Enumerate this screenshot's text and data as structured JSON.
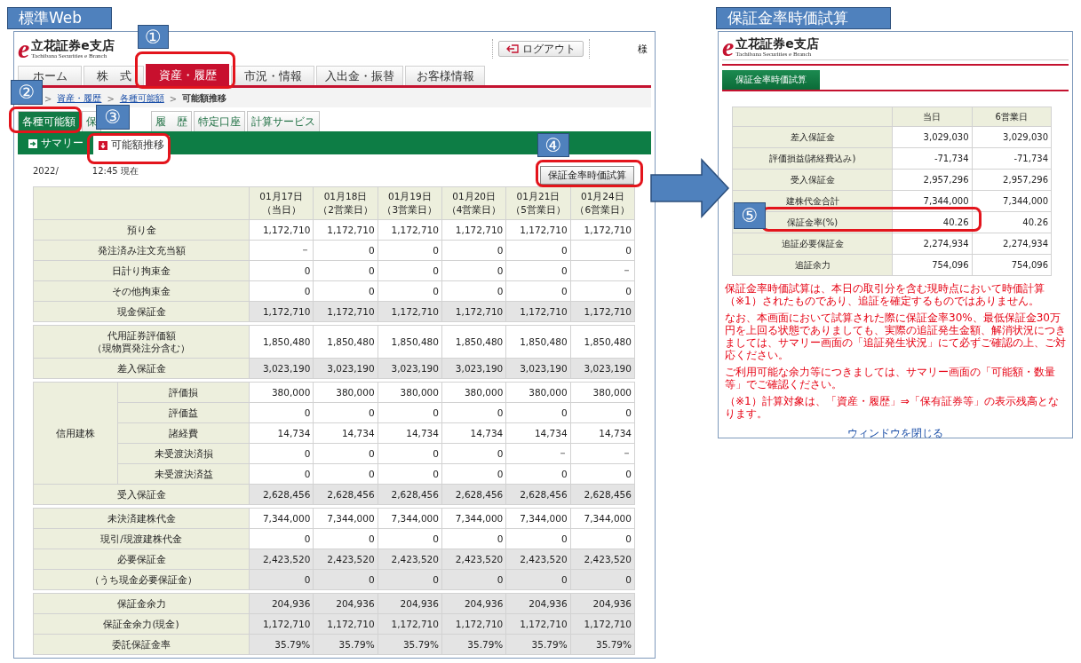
{
  "left_caption": "標準Web",
  "main_site": {
    "logo": {
      "mark": "e",
      "name": "立花証券e支店",
      "tagline": "Tachibana Securities e Branch"
    },
    "logout": "ログアウト",
    "user_suffix": "様",
    "nav": [
      {
        "label": "ホーム",
        "selected": false
      },
      {
        "label": "株　式",
        "selected": false
      },
      {
        "label": "資産・履歴",
        "selected": true
      },
      {
        "label": "市況・情報",
        "selected": false
      },
      {
        "label": "入出金・振替",
        "selected": false
      },
      {
        "label": "お客様情報",
        "selected": false
      }
    ],
    "breadcrumb": {
      "separator": ">",
      "items": [
        {
          "label": "資産・履歴",
          "link": true
        },
        {
          "label": "各種可能額",
          "link": true
        },
        {
          "label": "可能額推移",
          "link": false
        }
      ]
    },
    "subtabs": [
      {
        "label": "各種可能額",
        "selected": true
      },
      {
        "label": "保",
        "selected": false
      },
      {
        "label": "履　歴",
        "selected": false
      },
      {
        "label": "特定口座",
        "selected": false
      },
      {
        "label": "計算サービス",
        "selected": false
      }
    ],
    "view_tabs": [
      {
        "label": "サマリー",
        "selected": false
      },
      {
        "label": "可能額推移",
        "selected": true
      }
    ],
    "date": "2022/",
    "time": "12:45 現在",
    "calc_button": "保証金率時価試算",
    "table": {
      "columns": [
        {
          "date": "01月17日",
          "day": "（当日）"
        },
        {
          "date": "01月18日",
          "day": "（2営業日）"
        },
        {
          "date": "01月19日",
          "day": "（3営業日）"
        },
        {
          "date": "01月20日",
          "day": "（4営業日）"
        },
        {
          "date": "01月21日",
          "day": "（5営業日）"
        },
        {
          "date": "01月24日",
          "day": "（6営業日）"
        }
      ],
      "groups": [
        {
          "rows": [
            {
              "label": "預り金",
              "shaded": false,
              "values": [
                "1,172,710",
                "1,172,710",
                "1,172,710",
                "1,172,710",
                "1,172,710",
                "1,172,710"
              ]
            },
            {
              "label": "発注済み注文充当額",
              "shaded": false,
              "values": [
                "－",
                "0",
                "0",
                "0",
                "0",
                "0"
              ]
            },
            {
              "label": "日計り拘束金",
              "shaded": false,
              "values": [
                "0",
                "0",
                "0",
                "0",
                "0",
                "－"
              ]
            },
            {
              "label": "その他拘束金",
              "shaded": false,
              "values": [
                "0",
                "0",
                "0",
                "0",
                "0",
                "0"
              ]
            },
            {
              "label": "現金保証金",
              "shaded": true,
              "values": [
                "1,172,710",
                "1,172,710",
                "1,172,710",
                "1,172,710",
                "1,172,710",
                "1,172,710"
              ]
            }
          ]
        },
        {
          "rows": [
            {
              "label": "代用証券評価額（現物買発注分含む）",
              "shaded": false,
              "values": [
                "1,850,480",
                "1,850,480",
                "1,850,480",
                "1,850,480",
                "1,850,480",
                "1,850,480"
              ]
            },
            {
              "label": "差入保証金",
              "shaded": true,
              "values": [
                "3,023,190",
                "3,023,190",
                "3,023,190",
                "3,023,190",
                "3,023,190",
                "3,023,190"
              ]
            }
          ]
        },
        {
          "rows": [
            {
              "label": "信用建株",
              "children": [
                {
                  "label": "評価損",
                  "shaded": false,
                  "values": [
                    "380,000",
                    "380,000",
                    "380,000",
                    "380,000",
                    "380,000",
                    "380,000"
                  ]
                },
                {
                  "label": "評価益",
                  "shaded": false,
                  "values": [
                    "0",
                    "0",
                    "0",
                    "0",
                    "0",
                    "0"
                  ]
                },
                {
                  "label": "諸経費",
                  "shaded": false,
                  "values": [
                    "14,734",
                    "14,734",
                    "14,734",
                    "14,734",
                    "14,734",
                    "14,734"
                  ]
                },
                {
                  "label": "未受渡決済損",
                  "shaded": false,
                  "values": [
                    "0",
                    "0",
                    "0",
                    "0",
                    "－",
                    "－"
                  ]
                },
                {
                  "label": "未受渡決済益",
                  "shaded": false,
                  "values": [
                    "0",
                    "0",
                    "0",
                    "0",
                    "0",
                    "0"
                  ]
                }
              ]
            },
            {
              "label": "受入保証金",
              "shaded": true,
              "values": [
                "2,628,456",
                "2,628,456",
                "2,628,456",
                "2,628,456",
                "2,628,456",
                "2,628,456"
              ]
            }
          ]
        },
        {
          "rows": [
            {
              "label": "未決済建株代金",
              "shaded": false,
              "values": [
                "7,344,000",
                "7,344,000",
                "7,344,000",
                "7,344,000",
                "7,344,000",
                "7,344,000"
              ]
            },
            {
              "label": "現引/現渡建株代金",
              "shaded": false,
              "values": [
                "0",
                "0",
                "0",
                "0",
                "0",
                "0"
              ]
            },
            {
              "label": "必要保証金",
              "shaded": true,
              "values": [
                "2,423,520",
                "2,423,520",
                "2,423,520",
                "2,423,520",
                "2,423,520",
                "2,423,520"
              ]
            },
            {
              "label": "（うち現金必要保証金）",
              "shaded": true,
              "values": [
                "0",
                "0",
                "0",
                "0",
                "0",
                "0"
              ]
            }
          ]
        },
        {
          "rows": [
            {
              "label": "保証金余力",
              "shaded": true,
              "values": [
                "204,936",
                "204,936",
                "204,936",
                "204,936",
                "204,936",
                "204,936"
              ]
            },
            {
              "label": "保証金余力(現金)",
              "shaded": true,
              "values": [
                "1,172,710",
                "1,172,710",
                "1,172,710",
                "1,172,710",
                "1,172,710",
                "1,172,710"
              ]
            },
            {
              "label": "委託保証金率",
              "shaded": true,
              "values": [
                "35.79%",
                "35.79%",
                "35.79%",
                "35.79%",
                "35.79%",
                "35.79%"
              ]
            }
          ]
        }
      ]
    }
  },
  "right_caption": "保証金率時価試算",
  "popup": {
    "logo": {
      "mark": "e",
      "name": "立花証券e支店",
      "tagline": "Tachibana Securities e Branch"
    },
    "tab": {
      "label": "保証金率時価試算",
      "selected": true
    },
    "columns": [
      "当日",
      "6営業日"
    ],
    "rows": [
      {
        "label": "差入保証金",
        "values": [
          "3,029,030",
          "3,029,030"
        ]
      },
      {
        "label": "評価損益(諸経費込み)",
        "values": [
          "-71,734",
          "-71,734"
        ]
      },
      {
        "label": "受入保証金",
        "values": [
          "2,957,296",
          "2,957,296"
        ]
      },
      {
        "label": "建株代金合計",
        "values": [
          "7,344,000",
          "7,344,000"
        ]
      },
      {
        "label": "保証金率(%)",
        "values": [
          "40.26",
          "40.26"
        ]
      },
      {
        "label": "追証必要保証金",
        "values": [
          "2,274,934",
          "2,274,934"
        ]
      },
      {
        "label": "追証余力",
        "values": [
          "754,096",
          "754,096"
        ]
      }
    ],
    "notes": [
      "保証金率時価試算は、本日の取引分を含む現時点において時価計算（※1）されたものであり、追証を確定するものではありません。",
      "なお、本画面において試算された際に保証金率30%、最低保証金30万円を上回る状態でありましても、実際の追証発生金額、解消状況につきましては、サマリー画面の「追証発生状況」にて必ずご確認の上、ご対応ください。",
      "ご利用可能な余力等につきましては、サマリー画面の「可能額・数量等」でご確認ください。",
      "（※1）計算対象は、「資産・履歴」⇒「保有証券等」の表示残高となります。"
    ],
    "close_link": "ウィンドウを閉じる"
  },
  "annotations": [
    {
      "label": "①"
    },
    {
      "label": "②"
    },
    {
      "label": "③"
    },
    {
      "label": "④"
    },
    {
      "label": "⑤"
    }
  ]
}
